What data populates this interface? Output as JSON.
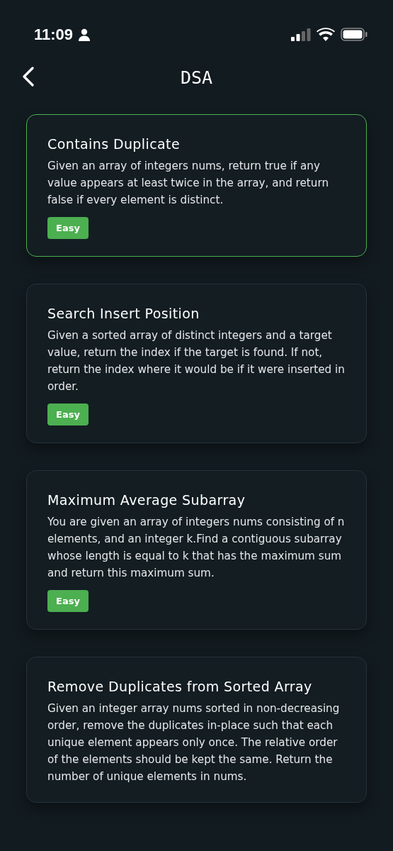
{
  "status_bar": {
    "time": "11:09"
  },
  "header": {
    "title": "DSA"
  },
  "problems": [
    {
      "title": "Contains Duplicate",
      "description": "Given an array of integers nums, return true if any value appears at least twice in the array, and return false if every element is distinct.",
      "difficulty": "Easy",
      "selected": true
    },
    {
      "title": "Search Insert Position",
      "description": "Given a sorted array of distinct integers and a target value, return the index if the target is found. If not, return the index where it would be if it were inserted in order.",
      "difficulty": "Easy",
      "selected": false
    },
    {
      "title": "Maximum Average Subarray",
      "description": "You are given an array of integers nums consisting of n elements, and an integer k.Find a contiguous subarray whose length is equal to k that has the maximum sum and return this maximum sum.",
      "difficulty": "Easy",
      "selected": false
    },
    {
      "title": "Remove Duplicates from Sorted Array",
      "description": "Given an integer array nums sorted in non-decreasing order, remove the duplicates in-place such that each unique element appears only once. The relative order of the elements should be kept the same. Return the number of unique elements in nums.",
      "selected": false
    }
  ]
}
